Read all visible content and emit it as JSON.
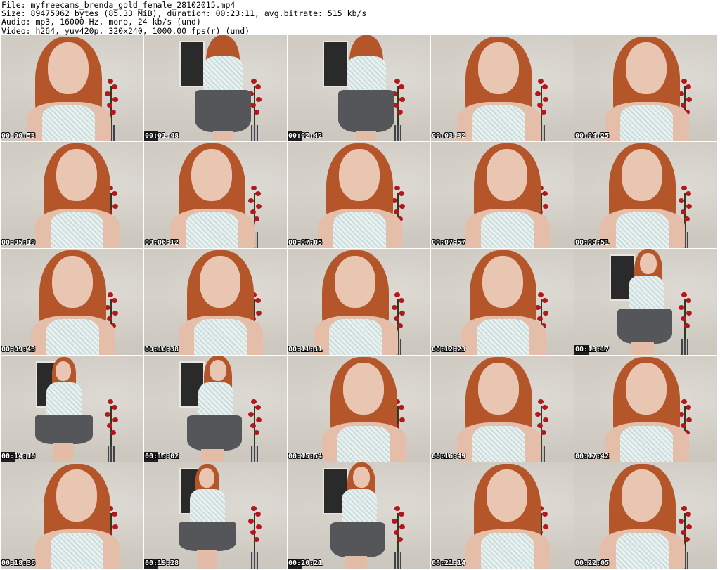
{
  "header": {
    "line1": "File: myfreecams_brenda_gold_female_28102015.mp4",
    "line2": "Size: 89475062 bytes (85.33 MiB), duration: 00:23:11, avg.bitrate: 515 kb/s",
    "line3": "Audio: mp3, 16000 Hz, mono, 24 kb/s (und)",
    "line4": "Video: h264, yuv420p, 320x240, 1000.00 fps(r) (und)"
  },
  "thumbnails": [
    {
      "time": "00:00:53",
      "pose": "close"
    },
    {
      "time": "00:01:48",
      "pose": "back"
    },
    {
      "time": "00:02:42",
      "pose": "back"
    },
    {
      "time": "00:03:32",
      "pose": "close"
    },
    {
      "time": "00:04:25",
      "pose": "close"
    },
    {
      "time": "00:05:19",
      "pose": "close"
    },
    {
      "time": "00:06:12",
      "pose": "close"
    },
    {
      "time": "00:07:05",
      "pose": "close"
    },
    {
      "time": "00:07:57",
      "pose": "close"
    },
    {
      "time": "00:08:51",
      "pose": "close"
    },
    {
      "time": "00:09:43",
      "pose": "close"
    },
    {
      "time": "00:10:38",
      "pose": "close"
    },
    {
      "time": "00:11:31",
      "pose": "close"
    },
    {
      "time": "00:12:23",
      "pose": "close"
    },
    {
      "time": "00:13:17",
      "pose": "side"
    },
    {
      "time": "00:14:10",
      "pose": "full"
    },
    {
      "time": "00:15:02",
      "pose": "side"
    },
    {
      "time": "00:15:54",
      "pose": "close"
    },
    {
      "time": "00:16:49",
      "pose": "close"
    },
    {
      "time": "00:17:42",
      "pose": "close"
    },
    {
      "time": "00:18:36",
      "pose": "close"
    },
    {
      "time": "00:19:28",
      "pose": "full"
    },
    {
      "time": "00:20:21",
      "pose": "side"
    },
    {
      "time": "00:21:14",
      "pose": "close"
    },
    {
      "time": "00:22:05",
      "pose": "close"
    }
  ]
}
